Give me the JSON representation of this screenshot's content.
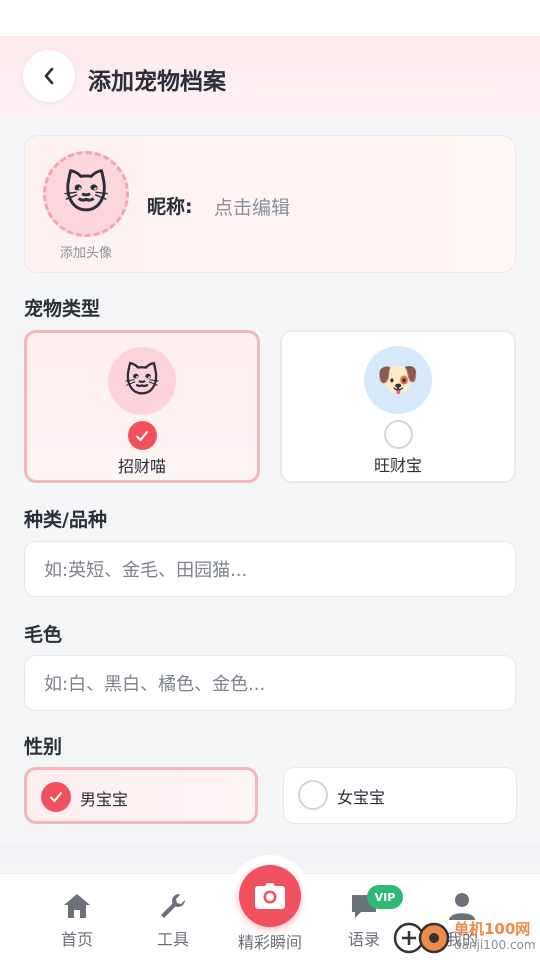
{
  "header": {
    "title": "添加宠物档案"
  },
  "profile": {
    "avatar_emoji": "🐱",
    "avatar_label": "添加头像",
    "nickname_label": "昵称:",
    "nickname_value": "点击编辑"
  },
  "pet_type": {
    "title": "宠物类型",
    "options": [
      {
        "label": "招财喵",
        "emoji": "🐱",
        "selected": true
      },
      {
        "label": "旺财宝",
        "emoji": "🐶",
        "selected": false
      }
    ]
  },
  "breed": {
    "title": "种类/品种",
    "placeholder": "如:英短、金毛、田园猫..."
  },
  "color": {
    "title": "毛色",
    "placeholder": "如:白、黑白、橘色、金色..."
  },
  "gender": {
    "title": "性别",
    "options": [
      {
        "label": "男宝宝",
        "selected": true
      },
      {
        "label": "女宝宝",
        "selected": false
      }
    ]
  },
  "tabbar": {
    "items": [
      {
        "label": "首页",
        "icon": "home-icon"
      },
      {
        "label": "工具",
        "icon": "wrench-icon"
      },
      {
        "label": "精彩瞬间",
        "icon": "camera-icon"
      },
      {
        "label": "语录",
        "icon": "chat-icon"
      },
      {
        "label": "我的",
        "icon": "user-icon"
      }
    ],
    "vip_badge": "VIP"
  },
  "watermark": {
    "line1": "单机100网",
    "line2": "danji100.com"
  },
  "colors": {
    "accent": "#f1505e",
    "vip": "#2fb873"
  }
}
